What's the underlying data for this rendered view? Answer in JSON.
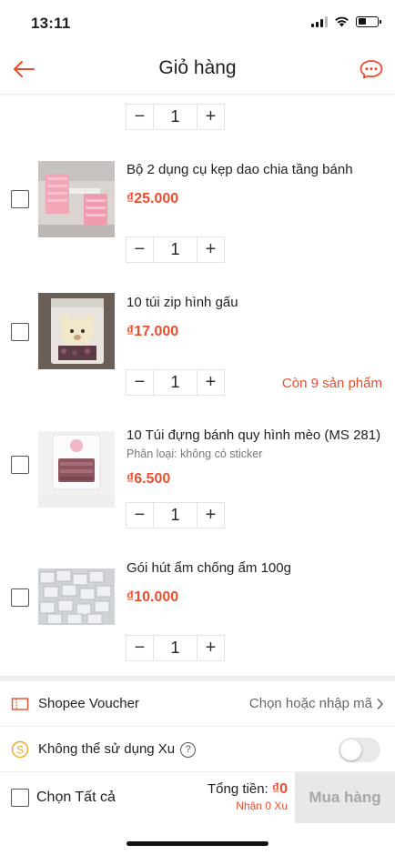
{
  "status_bar": {
    "time": "13:11"
  },
  "header": {
    "title": "Giỏ hàng",
    "back_icon": "arrow-left-icon",
    "chat_icon": "chat-bubble-icon",
    "accent": "#ee4d2d"
  },
  "top_partial_item": {
    "quantity": "1"
  },
  "items": [
    {
      "name": "Bộ 2 dụng cụ kẹp dao chia tầng bánh",
      "variant": "",
      "price": "₫25.000",
      "quantity": "1",
      "stock_note": ""
    },
    {
      "name": "10 túi zip hình gấu",
      "variant": "",
      "price": "₫17.000",
      "quantity": "1",
      "stock_note": "Còn 9 sản phẩm"
    },
    {
      "name": "10 Túi đựng bánh quy hình mèo (MS 281)",
      "variant": "Phân loại: không có sticker",
      "price": "₫6.500",
      "quantity": "1",
      "stock_note": ""
    },
    {
      "name": "Gói hút ẩm chống ẩm 100g",
      "variant": "",
      "price": "₫10.000",
      "quantity": "1",
      "stock_note": ""
    }
  ],
  "voucher": {
    "label": "Shopee Voucher",
    "action": "Chọn hoặc nhập mã"
  },
  "coins": {
    "label": "Không thể sử dụng Xu",
    "enabled": false
  },
  "bottom": {
    "select_all": "Chọn Tất cả",
    "total_label": "Tổng tiền:",
    "total_amount": "₫0",
    "coins_earned": "Nhận 0 Xu",
    "buy_button": "Mua hàng"
  },
  "colors": {
    "price": "#ee4d2d",
    "text": "#222222",
    "disabled_button_bg": "#e8e8e8"
  }
}
